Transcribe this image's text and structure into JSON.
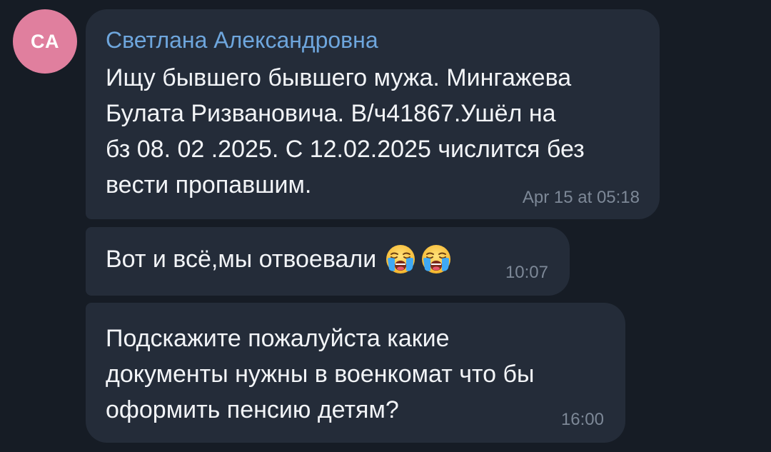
{
  "chat": {
    "avatar": {
      "initials": "CA",
      "color": "#e07f9e"
    },
    "sender": {
      "name": "Светлана Александровна",
      "name_color": "#6ea6dd"
    },
    "messages": [
      {
        "text": "Ищу бывшего бывшего мужа. Мингажева\nБулата Ризвановича. В/ч41867.Ушёл на\nбз 08. 02 .2025. С 12.02.2025 числится без\nвести пропавшим.",
        "time": "Apr 15 at 05:18"
      },
      {
        "text": "Вот и всё,мы отвоевали",
        "emojis": [
          "loudly-crying-face-emoji",
          "loudly-crying-face-emoji"
        ],
        "time": "10:07"
      },
      {
        "text": "Подскажите пожалуйста какие\nдокументы нужны в военкомат что бы\nоформить пенсию детям?",
        "time": "16:00"
      }
    ],
    "colors": {
      "background": "#161c25",
      "bubble": "#242c39",
      "text": "#f2f4f7",
      "time": "#7d8897"
    }
  }
}
